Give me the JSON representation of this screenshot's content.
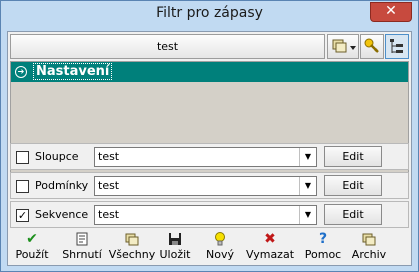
{
  "window": {
    "title": "Filtr pro zápasy",
    "close_glyph": "✕"
  },
  "header": {
    "name_value": "test",
    "toolbar": [
      {
        "icon": "copy-dropdown-icon"
      },
      {
        "icon": "key-icon"
      },
      {
        "icon": "tree-view-icon"
      }
    ]
  },
  "tree": {
    "selected_item": "Nastavení"
  },
  "rows": [
    {
      "label": "Sloupce",
      "checked": false,
      "value": "test",
      "edit_label": "Edit"
    },
    {
      "label": "Podmínky",
      "checked": false,
      "value": "test",
      "edit_label": "Edit"
    },
    {
      "label": "Sekvence",
      "checked": true,
      "value": "test",
      "edit_label": "Edit"
    }
  ],
  "bottom_buttons": [
    {
      "label": "Použít",
      "icon": "check-icon",
      "color": "#1c8f1c"
    },
    {
      "label": "Shrnutí",
      "icon": "summary-icon",
      "color": "#555555"
    },
    {
      "label": "Všechny",
      "icon": "all-icon",
      "color": "#7a6a2a"
    },
    {
      "label": "Uložit",
      "icon": "save-icon",
      "color": "#222222"
    },
    {
      "label": "Nový",
      "icon": "bulb-icon",
      "color": "#e8c400"
    },
    {
      "label": "Vymazat",
      "icon": "delete-icon",
      "color": "#c01818"
    },
    {
      "label": "Pomoc",
      "icon": "help-icon",
      "color": "#1f6fc9"
    },
    {
      "label": "Archiv",
      "icon": "archive-icon",
      "color": "#7a6a2a"
    }
  ],
  "colors": {
    "tree_selection": "#00807b",
    "tree_background": "#d4d0c8",
    "title_bar": "#c1daf2",
    "close_button": "#c74a3e"
  }
}
